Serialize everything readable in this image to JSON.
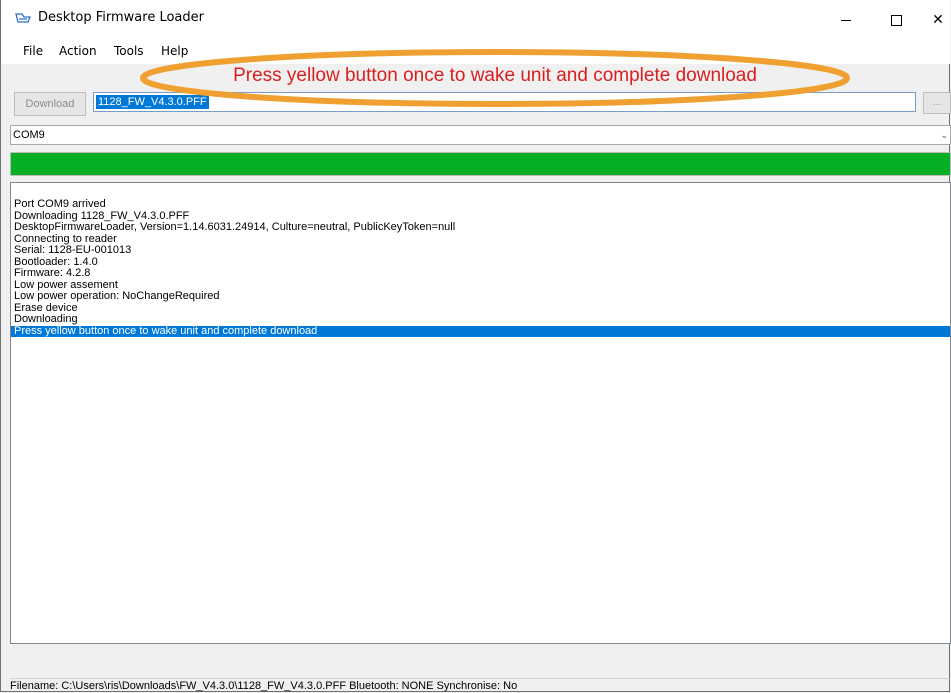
{
  "window": {
    "title": "Desktop Firmware Loader",
    "minimize_icon": "minimize-icon",
    "maximize_icon": "maximize-icon",
    "close_icon": "close-icon",
    "close_glyph": "✕"
  },
  "menu": {
    "items": [
      {
        "label": "File"
      },
      {
        "label": "Action"
      },
      {
        "label": "Tools"
      },
      {
        "label": "Help"
      }
    ]
  },
  "toolbar": {
    "download_label": "Download",
    "file_value": "1128_FW_V4.3.0.PFF",
    "browse_label": "..."
  },
  "port": {
    "selected": "COM9"
  },
  "progress": {
    "value_percent": 100,
    "color": "#06b025"
  },
  "log": {
    "lines": [
      "Port COM9 arrived",
      "Downloading 1128_FW_V4.3.0.PFF",
      "DesktopFirmwareLoader, Version=1.14.6031.24914, Culture=neutral, PublicKeyToken=null",
      "Connecting to reader",
      "Serial: 1128-EU-001013",
      "Bootloader: 1.4.0",
      "Firmware: 4.2.8",
      "Low power assement",
      "Low power operation: NoChangeRequired",
      "Erase device",
      "Downloading",
      "Press yellow button once to wake unit and complete download"
    ],
    "selected_index": 11,
    "selection_color": "#0078d7"
  },
  "status": {
    "text": "Filename: C:\\Users\\ris\\Downloads\\FW_V4.3.0\\1128_FW_V4.3.0.PFF  Bluetooth: NONE  Synchronise: No"
  },
  "annotation": {
    "text": "Press yellow button once to wake unit and complete download",
    "ellipse_color": "#f0a030",
    "text_color": "#d92020"
  }
}
